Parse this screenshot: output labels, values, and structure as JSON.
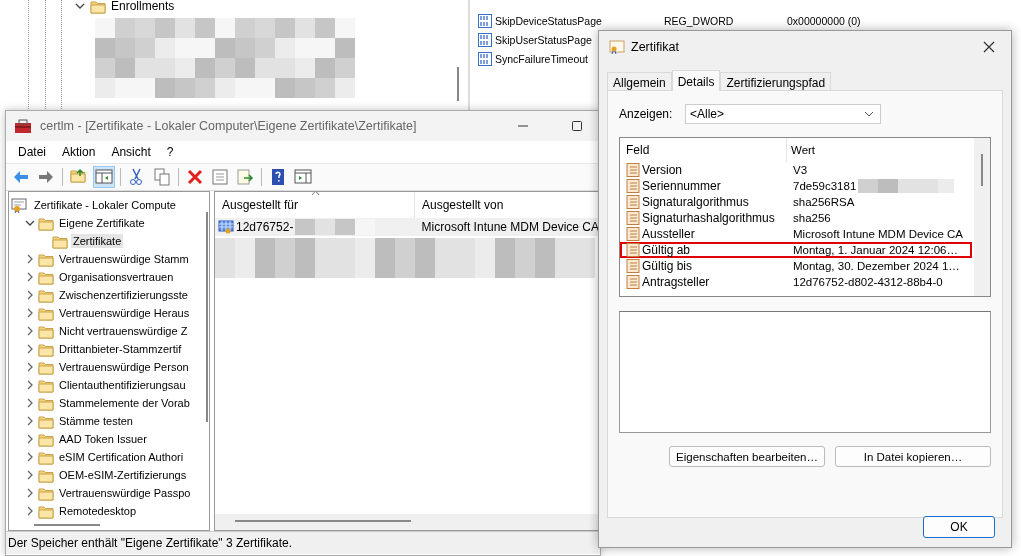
{
  "registry": {
    "tree": [
      {
        "label": "Enrollments",
        "expanded": true
      }
    ],
    "values": [
      {
        "name": "SkipDeviceStatusPage",
        "type": "REG_DWORD",
        "data": "0x00000000 (0)"
      },
      {
        "name": "SkipUserStatusPage"
      },
      {
        "name": "SyncFailureTimeout"
      }
    ]
  },
  "certlm": {
    "title": "certlm - [Zertifikate - Lokaler Computer\\Eigene Zertifikate\\Zertifikate]",
    "menu": [
      "Datei",
      "Aktion",
      "Ansicht",
      "?"
    ],
    "tree": [
      {
        "label": "Zertifikate - Lokaler Compute",
        "selected": false,
        "children": [
          {
            "label": "Eigene Zertifikate",
            "expanded": true,
            "selected": false,
            "children": [
              {
                "label": "Zertifikate",
                "selected": true
              }
            ]
          },
          {
            "label": "Vertrauenswürdige Stamm",
            "expanded": false,
            "selected": false
          },
          {
            "label": "Organisationsvertrauen",
            "expanded": false,
            "selected": false
          },
          {
            "label": "Zwischenzertifizierungsste",
            "expanded": false,
            "selected": false
          },
          {
            "label": "Vertrauenswürdige Heraus",
            "expanded": false,
            "selected": false
          },
          {
            "label": "Nicht vertrauenswürdige Z",
            "expanded": false,
            "selected": false
          },
          {
            "label": "Drittanbieter-Stammzertif",
            "expanded": false,
            "selected": false
          },
          {
            "label": "Vertrauenswürdige Person",
            "expanded": false,
            "selected": false
          },
          {
            "label": "Clientauthentifizierungsau",
            "expanded": false,
            "selected": false
          },
          {
            "label": "Stammelemente der Vorab",
            "expanded": false,
            "selected": false
          },
          {
            "label": "Stämme testen",
            "expanded": false,
            "selected": false
          },
          {
            "label": "AAD Token Issuer",
            "expanded": false,
            "selected": false
          },
          {
            "label": "eSIM Certification Authori",
            "expanded": false,
            "selected": false
          },
          {
            "label": "OEM-eSIM-Zertifizierungs",
            "expanded": false,
            "selected": false
          },
          {
            "label": "Vertrauenswürdige Passpo",
            "expanded": false,
            "selected": false
          },
          {
            "label": "Remotedesktop",
            "expanded": false,
            "selected": false
          }
        ]
      }
    ],
    "columns": [
      "Ausgestellt für",
      "Ausgestellt von"
    ],
    "rows": [
      {
        "issued_to": "12d76752-",
        "issued_by": "Microsoft Intune MDM Device CA"
      }
    ],
    "status_bar": "Der Speicher enthält \"Eigene Zertifikate\" 3 Zertifikate."
  },
  "dialog": {
    "title": "Zertifikat",
    "tabs": [
      {
        "label": "Allgemein",
        "selected": false
      },
      {
        "label": "Details",
        "selected": true
      },
      {
        "label": "Zertifizierungspfad",
        "selected": false
      }
    ],
    "show_label": "Anzeigen:",
    "show_value": "<Alle>",
    "columns": [
      "Feld",
      "Wert"
    ],
    "rows": [
      {
        "field": "Version",
        "value": "V3",
        "highlighted": false
      },
      {
        "field": "Seriennummer",
        "value": "7de59c3181",
        "highlighted": false
      },
      {
        "field": "Signaturalgorithmus",
        "value": "sha256RSA",
        "highlighted": false
      },
      {
        "field": "Signaturhashalgorithmus",
        "value": "sha256",
        "highlighted": false
      },
      {
        "field": "Aussteller",
        "value": "Microsoft Intune MDM Device CA",
        "highlighted": false
      },
      {
        "field": "Gültig ab",
        "value": "Montag, 1. Januar 2024 12:06…",
        "highlighted": true
      },
      {
        "field": "Gültig bis",
        "value": "Montag, 30. Dezember 2024 1…",
        "highlighted": false
      },
      {
        "field": "Antragsteller",
        "value": "12d76752-d802-4312-88b4-0",
        "highlighted": false
      }
    ],
    "buttons": [
      "Eigenschaften bearbeiten…",
      "In Datei kopieren…"
    ],
    "ok": "OK"
  }
}
